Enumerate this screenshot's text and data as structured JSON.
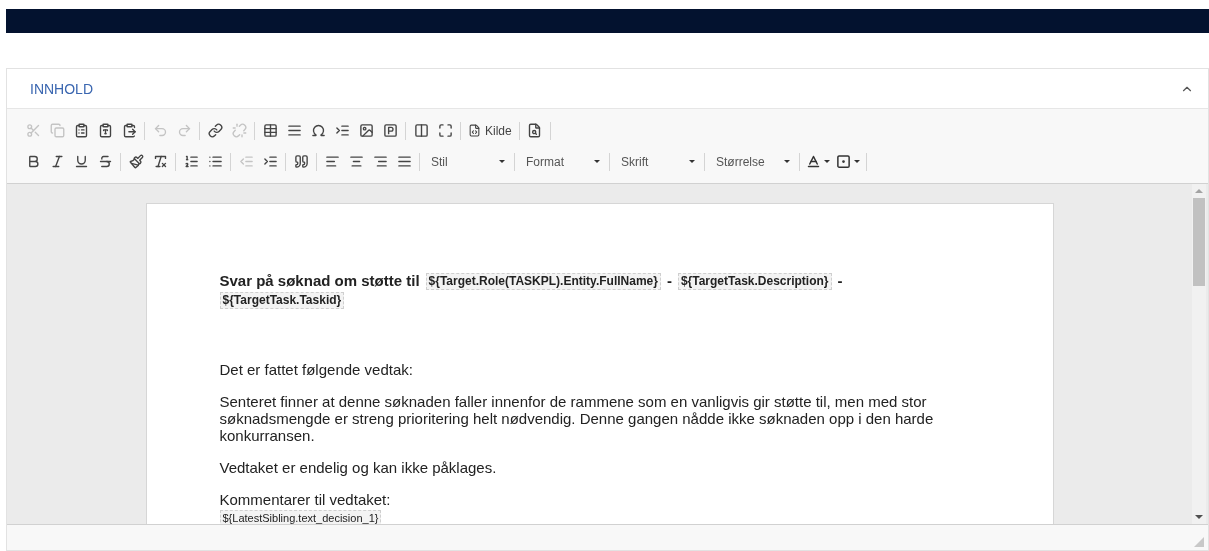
{
  "panel": {
    "title": "INNHOLD",
    "expanded": true
  },
  "toolbar": {
    "rows": [
      [
        [
          {
            "kind": "icon",
            "disabled": true
          },
          {
            "kind": "icon",
            "disabled": true
          },
          {
            "kind": "icon",
            "disabled": false
          },
          {
            "kind": "icon",
            "disabled": false
          },
          {
            "kind": "icon",
            "disabled": false
          }
        ],
        [
          {
            "kind": "icon",
            "disabled": true
          },
          {
            "kind": "icon",
            "disabled": true
          }
        ],
        [
          {
            "kind": "icon",
            "disabled": false
          },
          {
            "kind": "icon",
            "disabled": true
          }
        ],
        [
          {
            "kind": "icon",
            "disabled": false
          },
          {
            "kind": "icon",
            "disabled": false
          },
          {
            "kind": "icon",
            "disabled": false
          },
          {
            "kind": "icon",
            "disabled": false
          },
          {
            "kind": "icon",
            "disabled": false
          },
          {
            "kind": "icon",
            "disabled": false
          }
        ],
        [
          {
            "kind": "icon",
            "disabled": false
          },
          {
            "kind": "icon",
            "disabled": false
          }
        ],
        [
          {
            "kind": "text",
            "label": "Kilde",
            "disabled": false
          }
        ],
        [
          {
            "kind": "icon",
            "disabled": false
          }
        ]
      ],
      [
        [
          {
            "kind": "icon",
            "disabled": false
          },
          {
            "kind": "icon",
            "disabled": false
          },
          {
            "kind": "icon",
            "disabled": false
          },
          {
            "kind": "icon",
            "disabled": false
          }
        ],
        [
          {
            "kind": "icon",
            "disabled": false
          },
          {
            "kind": "icon",
            "disabled": false
          }
        ],
        [
          {
            "kind": "icon",
            "disabled": false
          },
          {
            "kind": "icon",
            "disabled": false
          }
        ],
        [
          {
            "kind": "icon",
            "disabled": true
          },
          {
            "kind": "icon",
            "disabled": false
          }
        ],
        [
          {
            "kind": "icon",
            "disabled": false
          }
        ],
        [
          {
            "kind": "icon",
            "disabled": false
          },
          {
            "kind": "icon",
            "disabled": false
          },
          {
            "kind": "icon",
            "disabled": false
          },
          {
            "kind": "icon",
            "disabled": false
          }
        ],
        [
          {
            "kind": "dropdown",
            "label": "Stil"
          }
        ],
        [
          {
            "kind": "dropdown",
            "label": "Format"
          }
        ],
        [
          {
            "kind": "dropdown",
            "label": "Skrift"
          }
        ],
        [
          {
            "kind": "dropdown",
            "label": "Størrelse"
          }
        ],
        [
          {
            "kind": "color",
            "disabled": false
          },
          {
            "kind": "color",
            "disabled": false
          }
        ]
      ]
    ]
  },
  "document": {
    "heading": [
      {
        "kind": "text",
        "text": "Svar på søknad om støtte til"
      },
      {
        "kind": "field",
        "text": "${Target.Role(TASKPL).Entity.FullName}"
      },
      {
        "kind": "text",
        "text": "-"
      },
      {
        "kind": "field",
        "text": "${TargetTask.Description}"
      },
      {
        "kind": "text",
        "text": "-"
      },
      {
        "kind": "field",
        "text": "${TargetTask.Taskid}"
      }
    ],
    "paragraphs": [
      [
        {
          "kind": "text",
          "text": "Det er fattet følgende vedtak:"
        }
      ],
      [
        {
          "kind": "text",
          "text": "Senteret finner at denne søknaden faller innenfor de rammene som en vanligvis gir støtte til, men med stor søknadsmengde er streng prioritering helt nødvendig. Denne gangen nådde ikke søknaden opp i den harde konkurransen."
        }
      ],
      [
        {
          "kind": "text",
          "text": "Vedtaket er endelig og kan ikke påklages."
        }
      ],
      [
        {
          "kind": "text",
          "text": "Kommentarer til vedtaket:"
        },
        {
          "kind": "break"
        },
        {
          "kind": "field",
          "text": "${LatestSibling.text_decision_1}"
        }
      ]
    ]
  }
}
